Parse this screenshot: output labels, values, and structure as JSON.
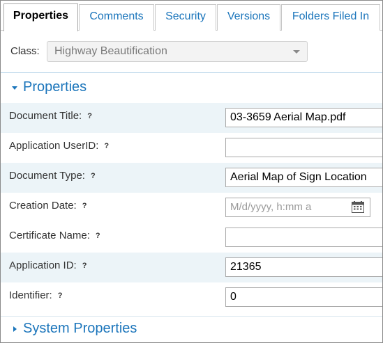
{
  "tabs": [
    {
      "label": "Properties",
      "active": true
    },
    {
      "label": "Comments",
      "active": false
    },
    {
      "label": "Security",
      "active": false
    },
    {
      "label": "Versions",
      "active": false
    },
    {
      "label": "Folders Filed In",
      "active": false
    }
  ],
  "class_field": {
    "label": "Class:",
    "value": "Highway Beautification",
    "icon": "chevron-down-icon"
  },
  "properties_section": {
    "title": "Properties",
    "expanded": true,
    "rows": [
      {
        "label": "Document Title:",
        "help": "?",
        "value": "03-3659 Aerial Map.pdf"
      },
      {
        "label": "Application UserID:",
        "help": "?",
        "value": ""
      },
      {
        "label": "Document Type:",
        "help": "?",
        "value": "Aerial Map of Sign Location"
      },
      {
        "label": "Creation Date:",
        "help": "?",
        "value": "",
        "placeholder": "M/d/yyyy, h:mm a",
        "icon": "calendar-icon"
      },
      {
        "label": "Certificate Name:",
        "help": "?",
        "value": ""
      },
      {
        "label": "Application ID:",
        "help": "?",
        "value": "21365"
      },
      {
        "label": "Identifier:",
        "help": "?",
        "value": "0"
      }
    ]
  },
  "system_section": {
    "title": "System Properties",
    "expanded": false
  },
  "colors": {
    "accent": "#1b75bb",
    "row_shade": "#ecf4f8",
    "disabled_bg": "#f3f3f3"
  }
}
